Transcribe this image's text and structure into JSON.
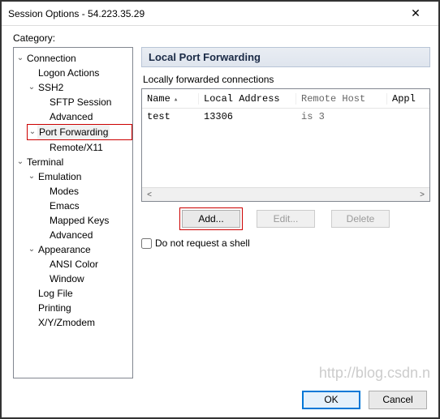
{
  "window": {
    "title": "Session Options - 54.223.35.29",
    "close": "✕"
  },
  "categoryLabel": "Category:",
  "tree": {
    "connection": "Connection",
    "logon": "Logon Actions",
    "ssh2": "SSH2",
    "sftp": "SFTP Session",
    "advanced1": "Advanced",
    "portfwd": "Port Forwarding",
    "remotex11": "Remote/X11",
    "terminal": "Terminal",
    "emulation": "Emulation",
    "modes": "Modes",
    "emacs": "Emacs",
    "mapped": "Mapped Keys",
    "advanced2": "Advanced",
    "appearance": "Appearance",
    "ansi": "ANSI Color",
    "windowItem": "Window",
    "logfile": "Log File",
    "printing": "Printing",
    "xyz": "X/Y/Zmodem"
  },
  "panel": {
    "header": "Local Port Forwarding",
    "groupLabel": "Locally forwarded connections",
    "columns": {
      "name": "Name",
      "local": "Local Address",
      "remote": "Remote Host",
      "app": "Appl"
    },
    "rows": [
      {
        "name": "test",
        "local": "13306",
        "remote": "is   3",
        "app": ""
      }
    ],
    "buttons": {
      "add": "Add...",
      "edit": "Edit...",
      "delete": "Delete"
    },
    "checkboxLabel": "Do not request a shell"
  },
  "footer": {
    "ok": "OK",
    "cancel": "Cancel"
  },
  "watermark": "http://blog.csdn.n"
}
